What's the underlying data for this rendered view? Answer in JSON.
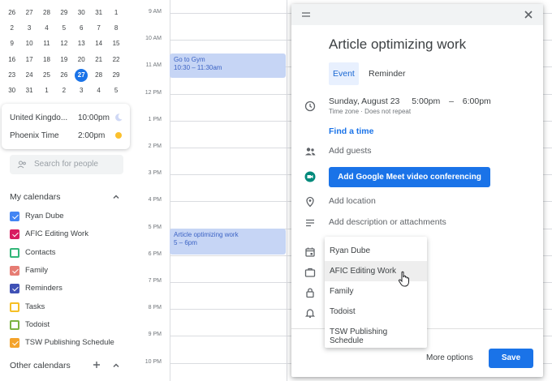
{
  "mini_calendar": {
    "weeks": [
      [
        "26",
        "27",
        "28",
        "29",
        "30",
        "31",
        "1"
      ],
      [
        "2",
        "3",
        "4",
        "5",
        "6",
        "7",
        "8"
      ],
      [
        "9",
        "10",
        "11",
        "12",
        "13",
        "14",
        "15"
      ],
      [
        "16",
        "17",
        "18",
        "19",
        "20",
        "21",
        "22"
      ],
      [
        "23",
        "24",
        "25",
        "26",
        "27",
        "28",
        "29"
      ],
      [
        "30",
        "31",
        "1",
        "2",
        "3",
        "4",
        "5"
      ]
    ],
    "today": "27"
  },
  "timezones": [
    {
      "name": "United Kingdo...",
      "time": "10:00pm",
      "icon": "moon-icon"
    },
    {
      "name": "Phoenix Time",
      "time": "2:00pm",
      "icon": "sun-icon"
    }
  ],
  "search_people": {
    "placeholder": "Search for people"
  },
  "my_calendars": {
    "title": "My calendars",
    "items": [
      {
        "label": "Ryan Dube",
        "color": "#4285f4",
        "checked": true
      },
      {
        "label": "AFIC Editing Work",
        "color": "#d81b60",
        "checked": true
      },
      {
        "label": "Contacts",
        "color": "#33b679",
        "checked": false
      },
      {
        "label": "Family",
        "color": "#e67c73",
        "checked": true
      },
      {
        "label": "Reminders",
        "color": "#3f51b5",
        "checked": true
      },
      {
        "label": "Tasks",
        "color": "#f6bf26",
        "checked": false
      },
      {
        "label": "Todoist",
        "color": "#7cb342",
        "checked": false
      },
      {
        "label": "TSW Publishing Schedule",
        "color": "#f4a32a",
        "checked": true
      }
    ]
  },
  "other_calendars": {
    "title": "Other calendars"
  },
  "time_labels": [
    "9 AM",
    "10 AM",
    "11 AM",
    "12 PM",
    "1 PM",
    "2 PM",
    "3 PM",
    "4 PM",
    "5 PM",
    "6 PM",
    "7 PM",
    "8 PM",
    "9 PM",
    "10 PM"
  ],
  "events": [
    {
      "title": "Go to Gym",
      "time": "10:30 – 11:30am"
    },
    {
      "title": "Article optimizing work",
      "time": "5 – 6pm"
    }
  ],
  "editor": {
    "title": "Article optimizing work",
    "tabs": [
      "Event",
      "Reminder"
    ],
    "date": "Sunday, August 23",
    "start": "5:00pm",
    "dash": "–",
    "end": "6:00pm",
    "timezone_note": "Time zone · Does not repeat",
    "find_time": "Find a time",
    "add_guests": "Add guests",
    "meet_button": "Add Google Meet video conferencing",
    "add_location": "Add location",
    "add_description": "Add description or attachments",
    "more_options": "More options",
    "save": "Save"
  },
  "calendar_dropdown": {
    "options": [
      "Ryan Dube",
      "AFIC Editing Work",
      "Family",
      "Todoist",
      "TSW Publishing Schedule"
    ],
    "hovered": "AFIC Editing Work"
  },
  "colors": {
    "accent": "#1a73e8",
    "event_bg": "#c6d5f5",
    "event_text": "#3c63c4"
  }
}
